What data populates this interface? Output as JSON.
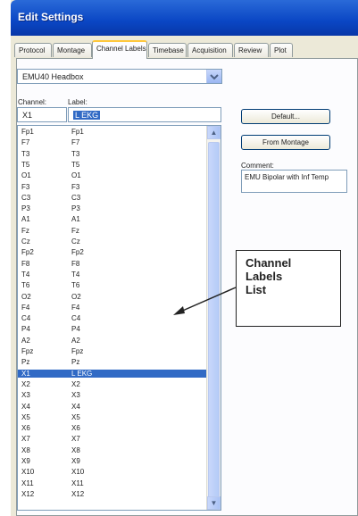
{
  "window": {
    "title": "Edit Settings"
  },
  "tabs": [
    {
      "label": "Protocol"
    },
    {
      "label": "Montage"
    },
    {
      "label": "Channel Labels",
      "active": true
    },
    {
      "label": "Timebase"
    },
    {
      "label": "Acquisition"
    },
    {
      "label": "Review"
    },
    {
      "label": "Plot"
    }
  ],
  "headbox": {
    "selected": "EMU40 Headbox"
  },
  "headers": {
    "channel": "Channel:",
    "label": "Label:"
  },
  "edit": {
    "channel": "X1",
    "label": "L EKG"
  },
  "buttons": {
    "default": "Default...",
    "from_montage": "From Montage"
  },
  "comment": {
    "label": "Comment:",
    "value": "EMU Bipolar with Inf Temp"
  },
  "callout": {
    "line1": "Channel",
    "line2": "Labels",
    "line3": "List"
  },
  "channels": [
    {
      "channel": "Fp1",
      "label": "Fp1"
    },
    {
      "channel": "F7",
      "label": "F7"
    },
    {
      "channel": "T3",
      "label": "T3"
    },
    {
      "channel": "T5",
      "label": "T5"
    },
    {
      "channel": "O1",
      "label": "O1"
    },
    {
      "channel": "F3",
      "label": "F3"
    },
    {
      "channel": "C3",
      "label": "C3"
    },
    {
      "channel": "P3",
      "label": "P3"
    },
    {
      "channel": "A1",
      "label": "A1"
    },
    {
      "channel": "Fz",
      "label": "Fz"
    },
    {
      "channel": "Cz",
      "label": "Cz"
    },
    {
      "channel": "Fp2",
      "label": "Fp2"
    },
    {
      "channel": "F8",
      "label": "F8"
    },
    {
      "channel": "T4",
      "label": "T4"
    },
    {
      "channel": "T6",
      "label": "T6"
    },
    {
      "channel": "O2",
      "label": "O2"
    },
    {
      "channel": "F4",
      "label": "F4"
    },
    {
      "channel": "C4",
      "label": "C4"
    },
    {
      "channel": "P4",
      "label": "P4"
    },
    {
      "channel": "A2",
      "label": "A2"
    },
    {
      "channel": "Fpz",
      "label": "Fpz"
    },
    {
      "channel": "Pz",
      "label": "Pz"
    },
    {
      "channel": "X1",
      "label": "L EKG",
      "selected": true
    },
    {
      "channel": "X2",
      "label": "X2"
    },
    {
      "channel": "X3",
      "label": "X3"
    },
    {
      "channel": "X4",
      "label": "X4"
    },
    {
      "channel": "X5",
      "label": "X5"
    },
    {
      "channel": "X6",
      "label": "X6"
    },
    {
      "channel": "X7",
      "label": "X7"
    },
    {
      "channel": "X8",
      "label": "X8"
    },
    {
      "channel": "X9",
      "label": "X9"
    },
    {
      "channel": "X10",
      "label": "X10"
    },
    {
      "channel": "X11",
      "label": "X11"
    },
    {
      "channel": "X12",
      "label": "X12"
    }
  ]
}
